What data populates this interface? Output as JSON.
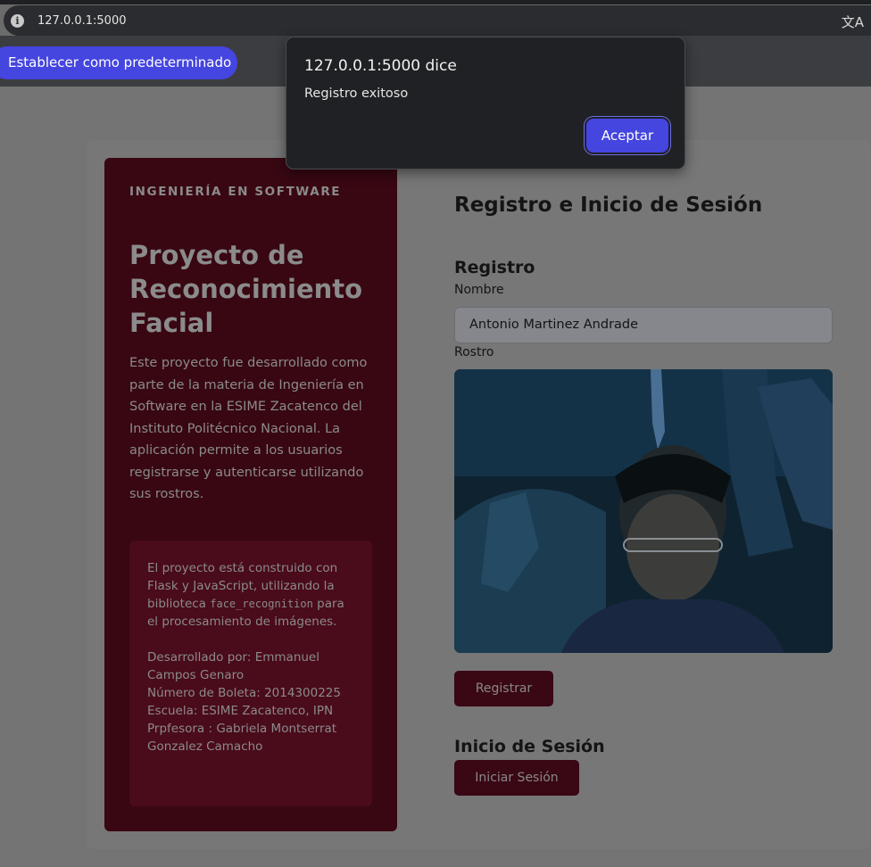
{
  "browser": {
    "url": "127.0.0.1:5000",
    "default_button": "Establecer como predeterminado"
  },
  "dialog": {
    "title": "127.0.0.1:5000 dice",
    "message": "Registro exitoso",
    "accept_label": "Aceptar"
  },
  "sidebar": {
    "eyebrow": "INGENIERÍA EN SOFTWARE",
    "title": "Proyecto de Reconocimiento Facial",
    "description": "Este proyecto fue desarrollado como parte de la materia de Ingeniería en Software en la ESIME Zacatenco del Instituto Politécnico Nacional. La aplicación permite a los usuarios registrarse y autenticarse utilizando sus rostros.",
    "info": {
      "text_before": "El proyecto está construido con Flask y JavaScript, utilizando la biblioteca",
      "code": "face_recognition",
      "text_after": "para el procesamiento de imágenes.",
      "developer": "Desarrollado por: Emmanuel Campos Genaro",
      "boleta": "Número de Boleta: 2014300225",
      "school": "Escuela: ESIME Zacatenco, IPN",
      "professor": "Prpfesora : Gabriela Montserrat Gonzalez Camacho"
    }
  },
  "main": {
    "heading": "Registro e Inicio de Sesión",
    "register": {
      "heading": "Registro",
      "name_label": "Nombre",
      "name_value": "Antonio Martinez Andrade",
      "face_label": "Rostro",
      "button": "Registrar"
    },
    "login": {
      "heading": "Inicio de Sesión",
      "button": "Iniciar Sesión"
    }
  },
  "colors": {
    "accent": "#4545e0",
    "sidebar_bg": "#380712",
    "button_bg": "#3a0714"
  }
}
